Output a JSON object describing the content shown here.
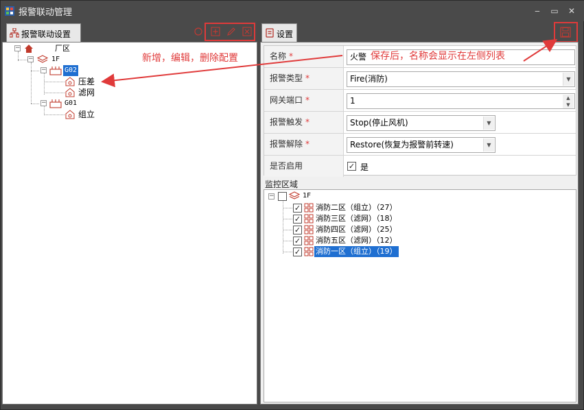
{
  "window": {
    "title": "报警联动管理",
    "controls": [
      "‒",
      "▭",
      "✕"
    ]
  },
  "left_tab": {
    "label": "报警联动设置"
  },
  "right_tab": {
    "label": "设置"
  },
  "tree": {
    "root": {
      "label": "厂区",
      "icon": "home-icon"
    },
    "floor": {
      "label": "1F",
      "icon": "layers-icon"
    },
    "groups": [
      {
        "label": "G02",
        "selected": true,
        "children": [
          "压差",
          "滤网"
        ]
      },
      {
        "label": "G01",
        "selected": false,
        "children": [
          "组立"
        ]
      }
    ]
  },
  "annotations": {
    "left_note": "新增，编辑，删除配置",
    "right_note": "保存后，名称会显示在左侧列表",
    "color": "#e03a3a"
  },
  "form": {
    "name": {
      "label": "名称",
      "required": "*",
      "value": "火警"
    },
    "alarm_type": {
      "label": "报警类型",
      "required": "*",
      "value": "Fire(消防)"
    },
    "gateway_port": {
      "label": "网关端口",
      "required": "*",
      "value": "1"
    },
    "alarm_trigger": {
      "label": "报警触发",
      "required": "*",
      "value": "Stop(停止风机)"
    },
    "alarm_release": {
      "label": "报警解除",
      "required": "*",
      "value": "Restore(恢复为报警前转速)"
    },
    "enabled": {
      "label": "是否启用",
      "checkbox_label": "是",
      "checked": true
    }
  },
  "monitor": {
    "title": "监控区域",
    "floor": "1F",
    "zones": [
      {
        "label": "消防二区（组立）（27）",
        "checked": true,
        "selected": false
      },
      {
        "label": "消防三区（滤网）（18）",
        "checked": true,
        "selected": false
      },
      {
        "label": "消防四区（滤网）（25）",
        "checked": true,
        "selected": false
      },
      {
        "label": "消防五区（滤网）（12）",
        "checked": true,
        "selected": false
      },
      {
        "label": "消防一区（组立）（19）",
        "checked": true,
        "selected": true
      }
    ]
  },
  "colors": {
    "selection": "#1f6fd1",
    "accent_red": "#e03a3a",
    "chrome": "#4a4a4a"
  }
}
